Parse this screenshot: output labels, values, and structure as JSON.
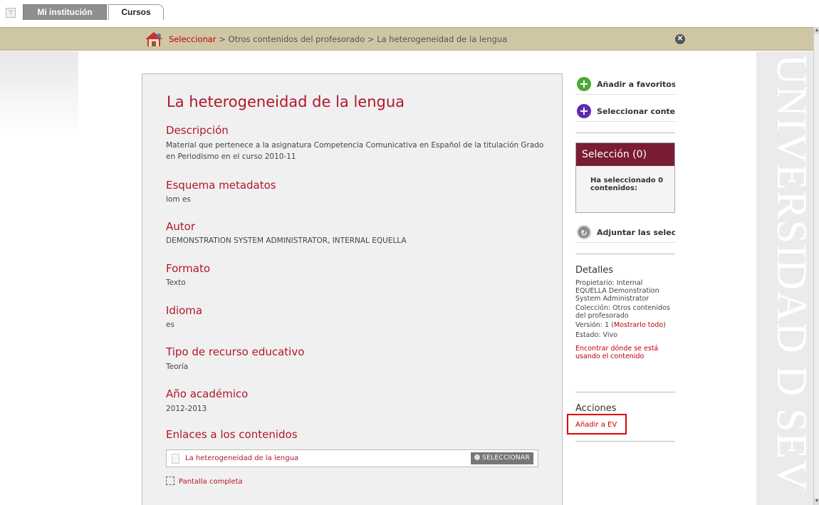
{
  "tabs": {
    "mi_institucion": "Mi institución",
    "cursos": "Cursos"
  },
  "breadcrumb": {
    "link": "Seleccionar",
    "rest": " > Otros contenidos del profesorado > La heterogeneidad de la lengua"
  },
  "watermark": "UNIVERSIDAD D SEV",
  "item": {
    "title": "La heterogeneidad de la lengua",
    "fields": [
      {
        "label": "Descripción",
        "value": "Material que pertenece a la asignatura Competencia Comunicativa en Español de la titulación Grado en Periodismo en el curso 2010-11"
      },
      {
        "label": "Esquema metadatos",
        "value": "lom es"
      },
      {
        "label": "Autor",
        "value": "DEMONSTRATION SYSTEM ADMINISTRATOR, INTERNAL EQUELLA"
      },
      {
        "label": "Formato",
        "value": "Texto"
      },
      {
        "label": "Idioma",
        "value": "es"
      },
      {
        "label": "Tipo de recurso educativo",
        "value": "Teoría"
      },
      {
        "label": "Año académico",
        "value": "2012-2013"
      }
    ],
    "links_heading": "Enlaces a los contenidos",
    "link_name": "La heterogeneidad de la lengua",
    "select_button": "SELECCIONAR",
    "fullscreen": "Pantalla completa"
  },
  "sidebar": {
    "add_favorites": "Añadir a favoritos",
    "select_content": "Seleccionar contenido",
    "selection_title": "Selección (0)",
    "selection_body": "Ha seleccionado 0 contenidos:",
    "attach": "Adjuntar las selecciones",
    "details_heading": "Detalles",
    "owner": "Propietario: Internal EQUELLA Demonstration System Administrator",
    "collection": "Colección: Otros contenidos del profesorado",
    "version_prefix": "Versión: 1 (",
    "version_link": "Mostrarlo todo",
    "version_suffix": ")",
    "status": "Estado: Vivo",
    "find_usage": "Encontrar dónde se está usando el contenido",
    "actions_heading": "Acciones",
    "add_ev": "Añadir a EV"
  },
  "colors": {
    "accent_red": "#b0172a",
    "selection_header": "#7a1c33",
    "breadcrumb_bar": "#cfc6a4",
    "highlight_border": "#e00000"
  }
}
